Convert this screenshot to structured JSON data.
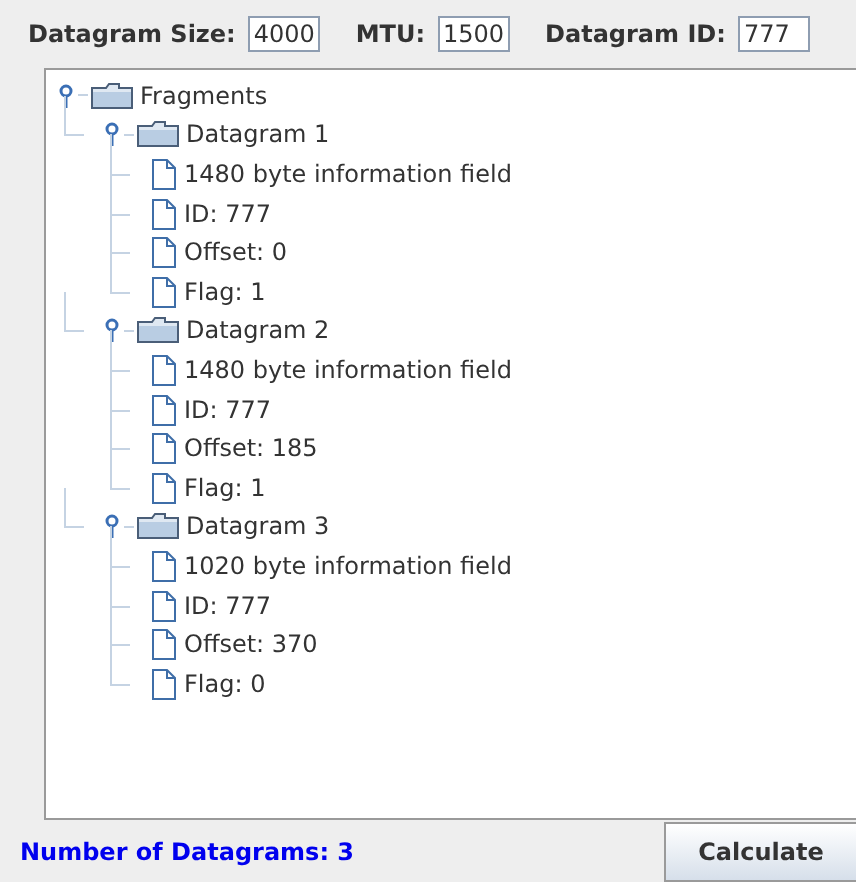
{
  "fields": [
    {
      "label": "Datagram Size:",
      "value": "4000"
    },
    {
      "label": "MTU:",
      "value": "1500"
    },
    {
      "label": "Datagram ID:",
      "value": "777"
    }
  ],
  "tree": {
    "label": "Fragments",
    "kind": "folder",
    "expanded": true,
    "children": [
      {
        "label": "Datagram 1",
        "kind": "folder",
        "expanded": true,
        "children": [
          {
            "label": "1480 byte information field",
            "kind": "file"
          },
          {
            "label": "ID: 777",
            "kind": "file"
          },
          {
            "label": "Offset: 0",
            "kind": "file"
          },
          {
            "label": "Flag: 1",
            "kind": "file"
          }
        ]
      },
      {
        "label": "Datagram 2",
        "kind": "folder",
        "expanded": true,
        "children": [
          {
            "label": "1480 byte information field",
            "kind": "file"
          },
          {
            "label": "ID: 777",
            "kind": "file"
          },
          {
            "label": "Offset: 185",
            "kind": "file"
          },
          {
            "label": "Flag: 1",
            "kind": "file"
          }
        ]
      },
      {
        "label": "Datagram 3",
        "kind": "folder",
        "expanded": true,
        "children": [
          {
            "label": "1020 byte information field",
            "kind": "file"
          },
          {
            "label": "ID: 777",
            "kind": "file"
          },
          {
            "label": "Offset: 370",
            "kind": "file"
          },
          {
            "label": "Flag: 0",
            "kind": "file"
          }
        ]
      }
    ]
  },
  "status": "Number of Datagrams: 3",
  "button": "Calculate"
}
